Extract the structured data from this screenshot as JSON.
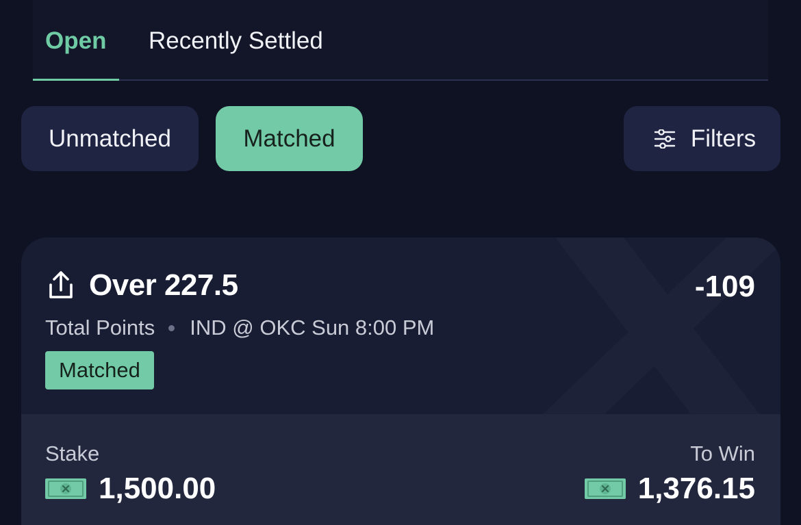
{
  "tabs": [
    {
      "label": "Open",
      "active": true
    },
    {
      "label": "Recently Settled",
      "active": false
    }
  ],
  "segments": {
    "unmatched_label": "Unmatched",
    "matched_label": "Matched",
    "active": "Matched"
  },
  "filters": {
    "label": "Filters",
    "icon": "sliders-icon"
  },
  "bet": {
    "title": "Over 227.5",
    "odds": "-109",
    "market": "Total Points",
    "event": "IND @ OKC Sun 8:00 PM",
    "status": "Matched",
    "stake_label": "Stake",
    "stake": "1,500.00",
    "to_win_label": "To Win",
    "to_win": "1,376.15",
    "share_icon": "share-icon",
    "currency_icon": "cash-icon"
  },
  "colors": {
    "background": "#0f1222",
    "accent": "#72cba6",
    "card": "#191d33",
    "pill": "#1f2443"
  }
}
